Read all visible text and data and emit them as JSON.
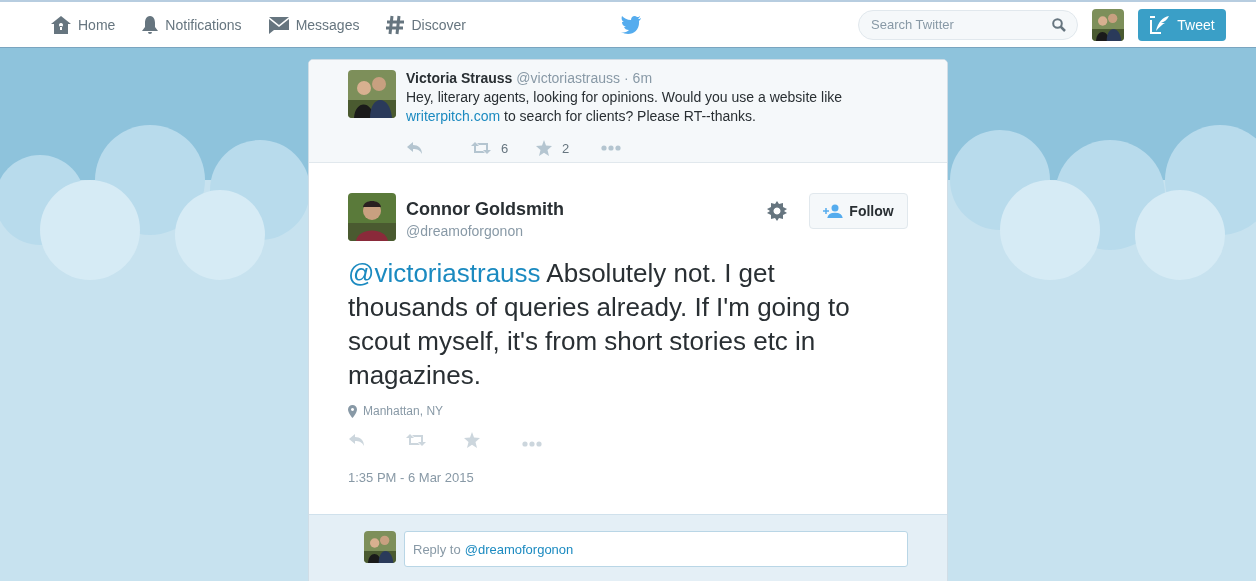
{
  "nav": {
    "items": [
      {
        "kind": "home",
        "label": "Home"
      },
      {
        "kind": "notifications",
        "label": "Notifications"
      },
      {
        "kind": "messages",
        "label": "Messages"
      },
      {
        "kind": "discover",
        "label": "Discover"
      }
    ],
    "search": {
      "placeholder": "Search Twitter"
    },
    "tweet_button": "Tweet"
  },
  "parent_tweet": {
    "name": "Victoria Strauss",
    "handle": "@victoriastrauss",
    "time": "· 6m",
    "text": [
      {
        "kind": "text",
        "text": "Hey, literary agents, looking for opinions. Would you use a website like"
      },
      {
        "kind": "link",
        "text": "writerpitch.com"
      },
      {
        "kind": "text",
        "text": "to search for clients? Please RT--thanks."
      }
    ],
    "actions": [
      {
        "kind": "reply"
      },
      {
        "kind": "retweet",
        "count": "6"
      },
      {
        "kind": "favorite",
        "count": "2"
      },
      {
        "kind": "more"
      }
    ]
  },
  "tweet": {
    "name": "Connor Goldsmith",
    "handle": "@dreamoforgonon",
    "follow": "Follow",
    "mention": "@victoriastrauss",
    "text": "Absolutely not. I get thousands of queries already. If I'm going to scout myself, it's from short stories etc in magazines.",
    "location": "Manhattan, NY",
    "actions": [
      {
        "kind": "reply"
      },
      {
        "kind": "retweet"
      },
      {
        "kind": "favorite"
      },
      {
        "kind": "more"
      }
    ],
    "timestamp": "1:35 PM - 6 Mar 2015"
  },
  "reply_box": {
    "prompt": "Reply to",
    "mention": "@dreamoforgonon"
  }
}
